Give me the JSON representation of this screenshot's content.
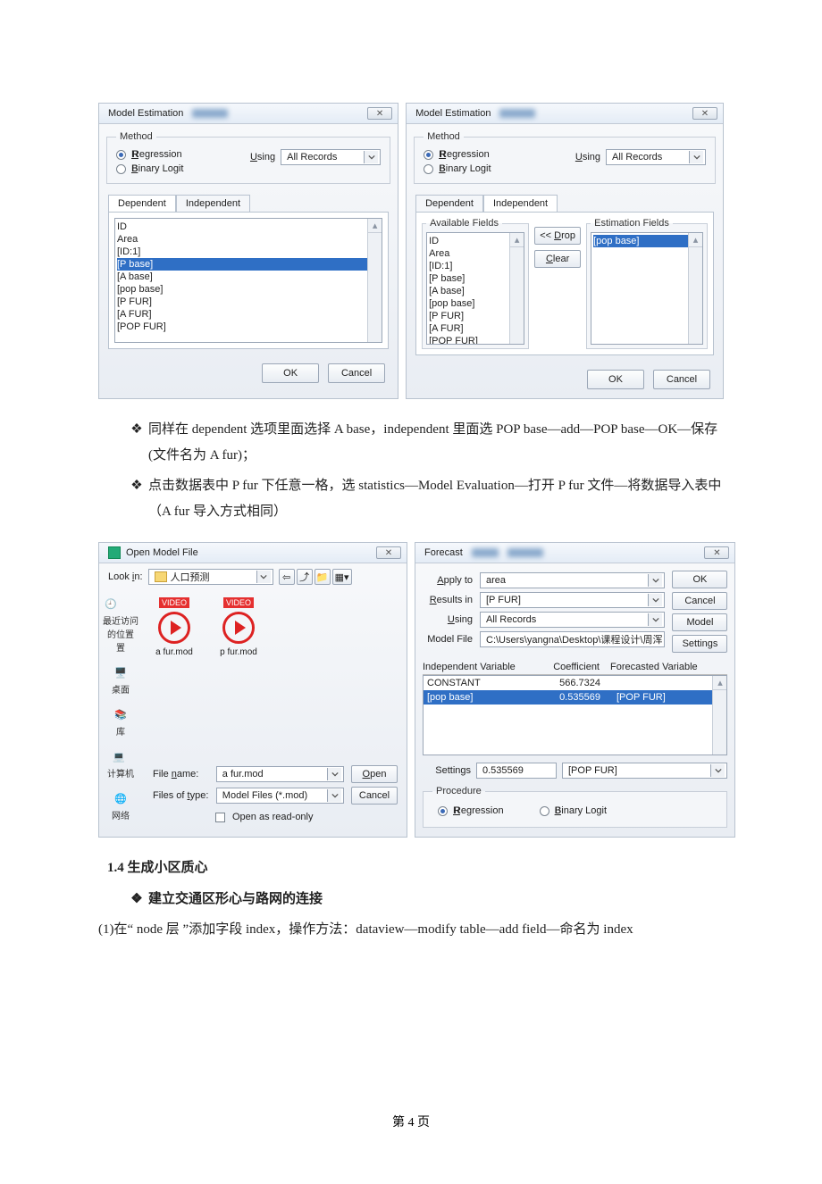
{
  "dialog1": {
    "title": "Model Estimation",
    "method": {
      "legend": "Method",
      "regression": "Regression",
      "binary": "Binary Logit",
      "using": "Using",
      "using_val": "All Records"
    },
    "tabs": {
      "dep": "Dependent",
      "indep": "Independent"
    },
    "fields": [
      "ID",
      "Area",
      "[ID:1]",
      "[P base]",
      "[A base]",
      "[pop base]",
      "[P FUR]",
      "[A FUR]",
      "[POP FUR]"
    ],
    "ok": "OK",
    "cancel": "Cancel"
  },
  "dialog2": {
    "title": "Model Estimation",
    "method": {
      "legend": "Method",
      "regression": "Regression",
      "binary": "Binary Logit",
      "using": "Using",
      "using_val": "All Records"
    },
    "tabs": {
      "dep": "Dependent",
      "indep": "Independent"
    },
    "avail_legend": "Available Fields",
    "est_legend": "Estimation Fields",
    "fields": [
      "ID",
      "Area",
      "[ID:1]",
      "[P base]",
      "[A base]",
      "[pop base]",
      "[P FUR]",
      "[A FUR]",
      "[POP FUR]"
    ],
    "est_field": "[pop base]",
    "drop": "<< Drop",
    "clear": "Clear",
    "ok": "OK",
    "cancel": "Cancel"
  },
  "text": {
    "b1": "同样在 dependent 选项里面选择 A base，independent 里面选 POP base—add—POP base—OK—保存(文件名为 A fur)；",
    "b2": "点击数据表中 P fur 下任意一格，选 statistics—Model Evaluation—打开 P fur 文件—将数据导入表中（A fur 导入方式相同）",
    "h14": "1.4 生成小区质心",
    "b3": "建立交通区形心与路网的连接",
    "p1": "(1)在“ node 层 ”添加字段 index，操作方法：dataview—modify table—add field—命名为 index",
    "footer": "第 4 页"
  },
  "open": {
    "title": "Open Model File",
    "lookin": "Look in:",
    "folder": "人口预测",
    "side": {
      "recent": "最近访问的位置",
      "recent2": "置",
      "desktop": "桌面",
      "lib": "库",
      "pc": "计算机",
      "net": "网络"
    },
    "file1": "a fur.mod",
    "file2": "p fur.mod",
    "video": "VIDEO",
    "fname_lbl": "File name:",
    "fname_val": "a fur.mod",
    "ftype_lbl": "Files of type:",
    "ftype_val": "Model Files (*.mod)",
    "readonly": "Open as read-only",
    "open_btn": "Open",
    "cancel_btn": "Cancel"
  },
  "forecast": {
    "title": "Forecast",
    "apply": "Apply to",
    "apply_v": "area",
    "results": "Results in",
    "results_v": "[P FUR]",
    "using": "Using",
    "using_v": "All Records",
    "modelfile": "Model File",
    "modelfile_v": "C:\\Users\\yangna\\Desktop\\课程设计\\周浑",
    "hdr1": "Independent Variable",
    "hdr2": "Coefficient",
    "hdr3": "Forecasted Variable",
    "row1_c1": "CONSTANT",
    "row1_c2": "566.7324",
    "row2_c1": "[pop base]",
    "row2_c2": "0.535569",
    "row2_c3": "[POP FUR]",
    "settings": "Settings",
    "settings_v": "0.535569",
    "settings_v2": "[POP FUR]",
    "proc_legend": "Procedure",
    "reg": "Regression",
    "bin": "Binary Logit",
    "btn_ok": "OK",
    "btn_cancel": "Cancel",
    "btn_model": "Model",
    "btn_settings": "Settings"
  }
}
